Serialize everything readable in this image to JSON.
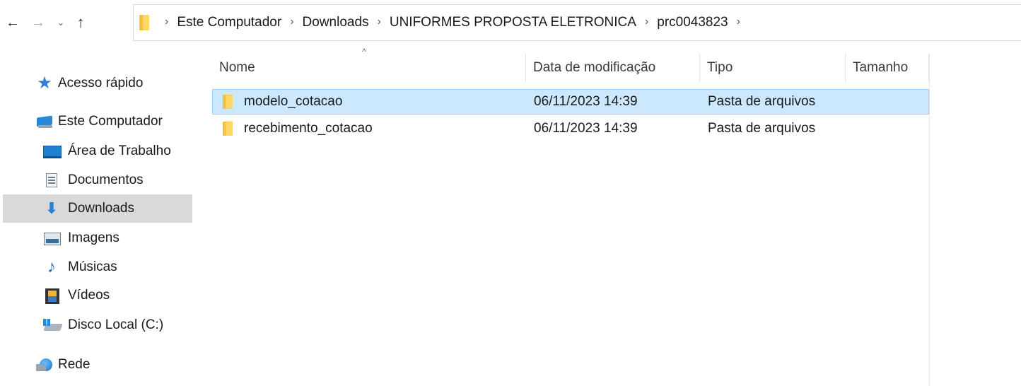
{
  "navigation": {
    "back_icon": "←",
    "forward_icon": "→",
    "recent_icon": "⌄",
    "up_icon": "↑"
  },
  "address_bar": {
    "separator": "›",
    "crumbs": [
      "Este Computador",
      "Downloads",
      "UNIFORMES PROPOSTA ELETRONICA",
      "prc0043823"
    ]
  },
  "nav_pane": {
    "items": [
      {
        "label": "Acesso rápido",
        "icon": "star-icon"
      },
      {
        "label": "Este Computador",
        "icon": "computer-icon"
      },
      {
        "label": "Área de Trabalho",
        "icon": "desktop-icon"
      },
      {
        "label": "Documentos",
        "icon": "documents-icon"
      },
      {
        "label": "Downloads",
        "icon": "download-icon",
        "selected": true
      },
      {
        "label": "Imagens",
        "icon": "pictures-icon"
      },
      {
        "label": "Músicas",
        "icon": "music-icon"
      },
      {
        "label": "Vídeos",
        "icon": "videos-icon"
      },
      {
        "label": "Disco Local (C:)",
        "icon": "disk-icon"
      },
      {
        "label": "Rede",
        "icon": "network-icon"
      }
    ]
  },
  "file_list": {
    "sort_indicator": "^",
    "columns": {
      "name": "Nome",
      "date": "Data de modificação",
      "type": "Tipo",
      "size": "Tamanho"
    },
    "rows": [
      {
        "name": "modelo_cotacao",
        "date": "06/11/2023 14:39",
        "type": "Pasta de arquivos",
        "size": "",
        "selected": true
      },
      {
        "name": "recebimento_cotacao",
        "date": "06/11/2023 14:39",
        "type": "Pasta de arquivos",
        "size": ""
      }
    ]
  },
  "colors": {
    "selection_bg": "#cce8ff",
    "selection_border": "#99d1ff",
    "nav_selected_bg": "#d9d9d9",
    "folder_yellow": "#ffd766"
  }
}
